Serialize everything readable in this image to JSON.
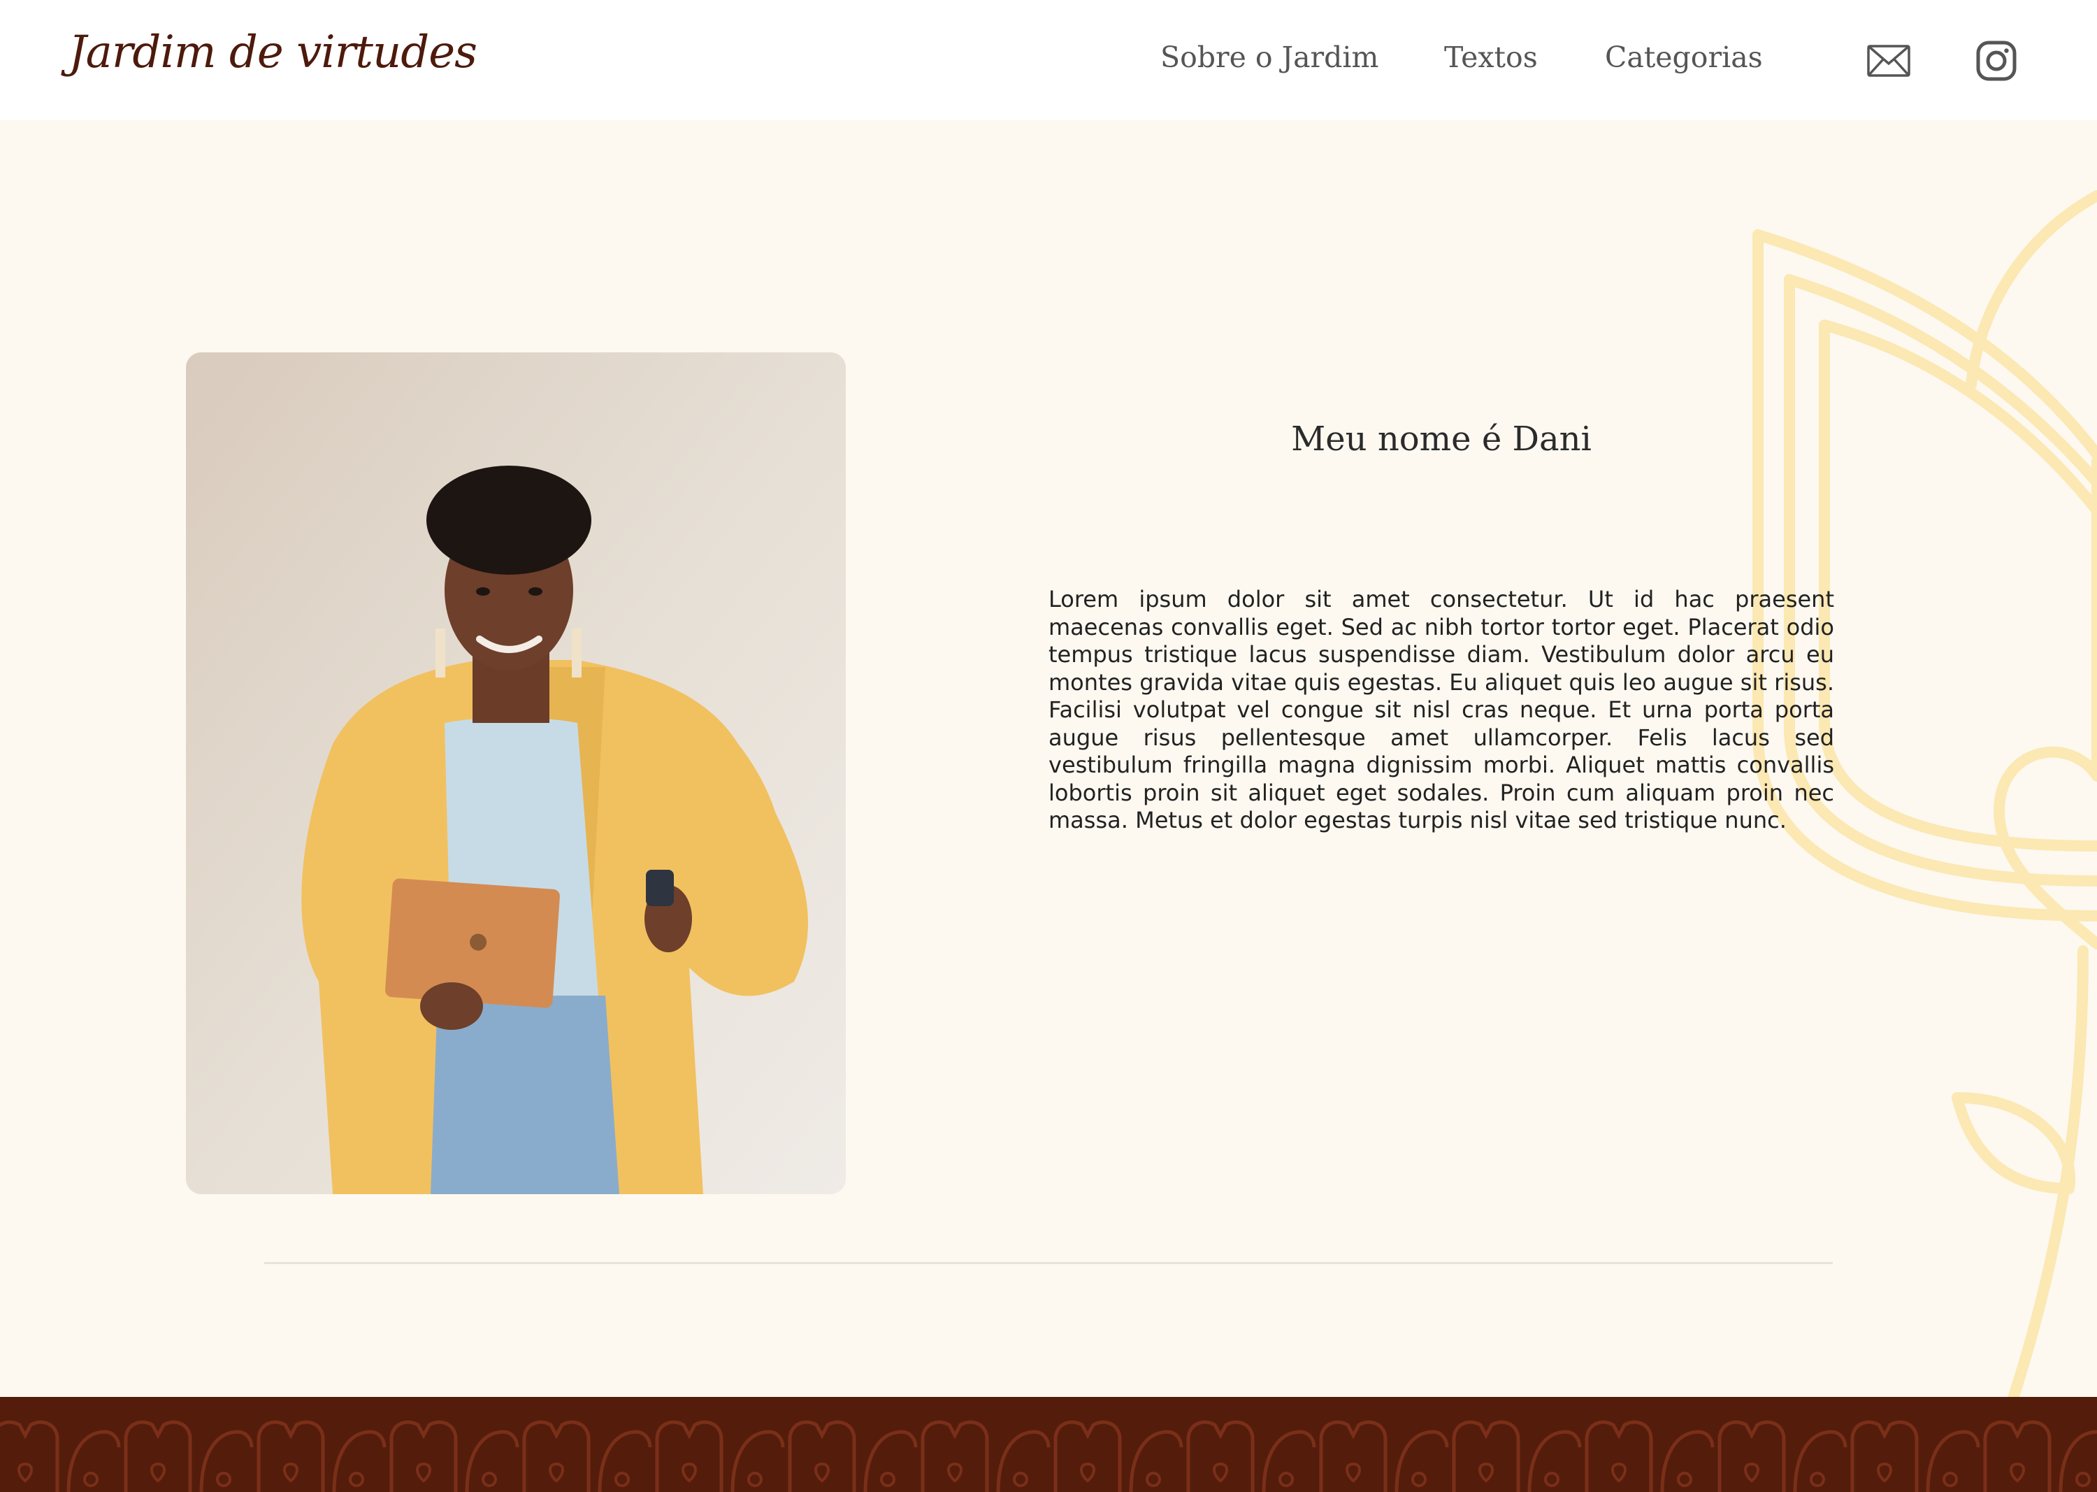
{
  "header": {
    "logo_text": "Jardim de virtudes",
    "nav": [
      {
        "label": "Sobre o Jardim"
      },
      {
        "label": "Textos"
      },
      {
        "label": "Categorias"
      }
    ],
    "icons": [
      "mail-icon",
      "instagram-icon"
    ]
  },
  "profile": {
    "title": "Meu nome é Dani",
    "bio": "Lorem ipsum dolor sit amet consectetur. Ut id hac praesent maecenas convallis eget. Sed ac nibh tortor tortor eget. Placerat odio tempus tristique lacus suspendisse diam. Vestibulum dolor arcu eu montes gravida vitae quis egestas. Eu aliquet quis leo augue sit risus. Facilisi volutpat vel congue sit nisl cras neque. Et urna porta porta augue risus pellentesque amet ullamcorper. Felis lacus sed vestibulum fringilla magna dignissim morbi. Aliquet mattis convallis lobortis proin sit aliquet eget sodales. Proin cum aliquam proin nec massa. Metus et dolor egestas turpis nisl vitae sed tristique nunc."
  },
  "colors": {
    "brand": "#4d1a0c",
    "footer": "#541c0b",
    "background": "#fdf9f1",
    "decoration": "#fbe8b3"
  }
}
